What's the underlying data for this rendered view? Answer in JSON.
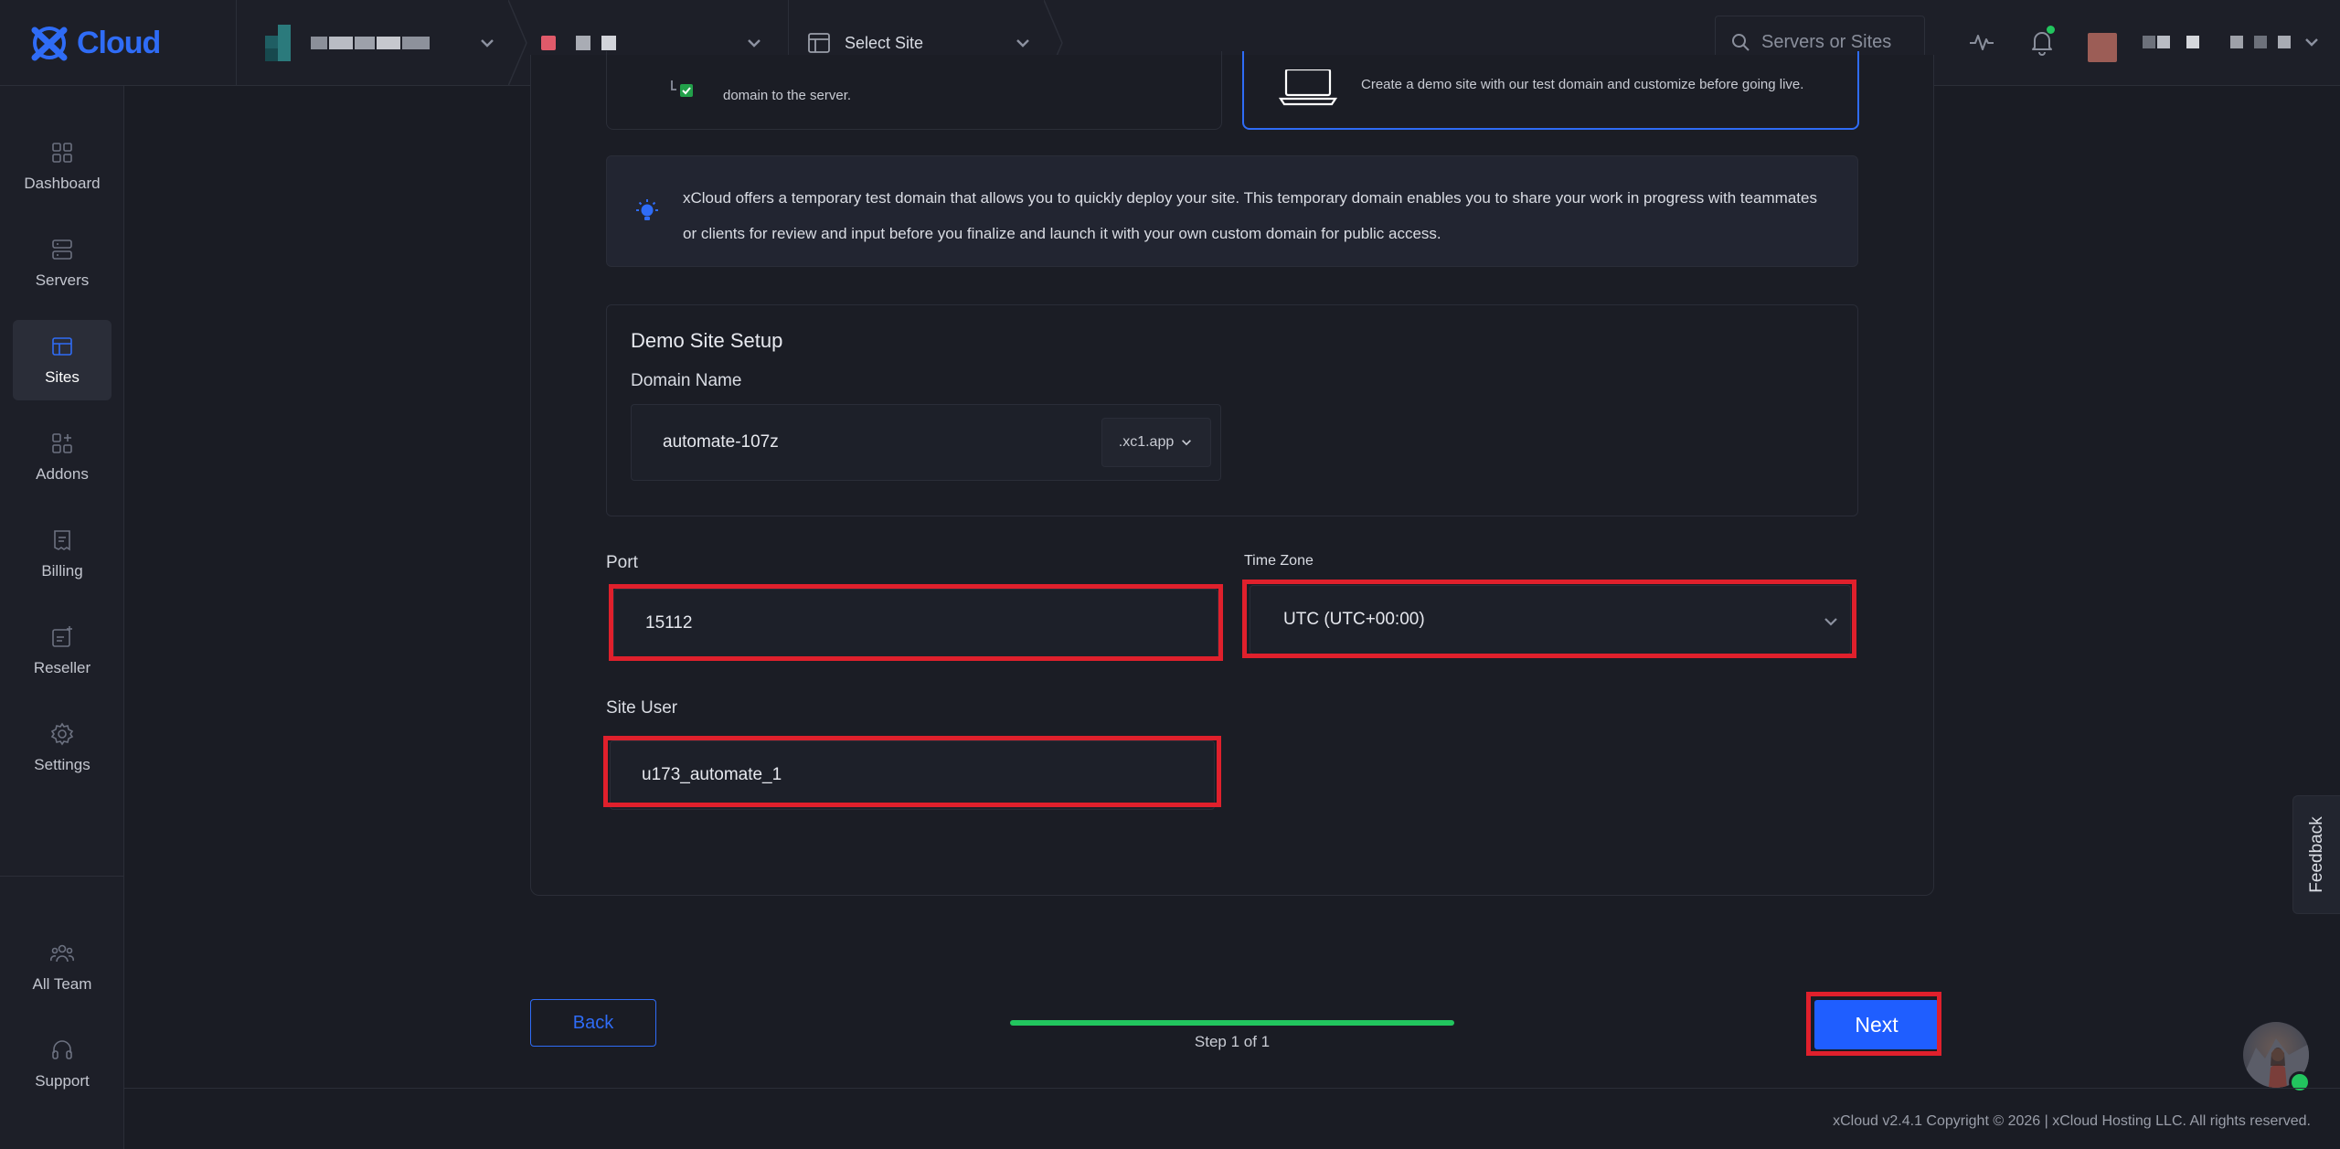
{
  "app": {
    "brand": "Cloud",
    "brand_color": "#2f6cf6",
    "accent_green": "#22c55e",
    "highlight_color": "#e0202c"
  },
  "topbar": {
    "select_site_label": "Select Site",
    "search_placeholder": "Servers or Sites"
  },
  "sidebar": {
    "items": [
      {
        "label": "Dashboard",
        "icon": "dashboard-icon"
      },
      {
        "label": "Servers",
        "icon": "servers-icon"
      },
      {
        "label": "Sites",
        "icon": "sites-icon",
        "active": true
      },
      {
        "label": "Addons",
        "icon": "addons-icon"
      },
      {
        "label": "Billing",
        "icon": "billing-icon"
      },
      {
        "label": "Reseller",
        "icon": "reseller-icon"
      },
      {
        "label": "Settings",
        "icon": "gear-icon"
      }
    ],
    "bottom_items": [
      {
        "label": "All Team",
        "icon": "team-icon"
      },
      {
        "label": "Support",
        "icon": "headset-icon"
      }
    ]
  },
  "options": {
    "left_text": "domain to the server.",
    "right_text": "Create a demo site with our test domain and customize before going live."
  },
  "info": {
    "text": "xCloud offers a temporary test domain that allows you to quickly deploy your site. This temporary domain enables you to share your work in progress with teammates or clients for review and input before you finalize and launch it with your own custom domain for public access."
  },
  "demo_setup": {
    "title": "Demo Site Setup",
    "domain_label": "Domain Name",
    "domain_value": "automate-107z",
    "tld": ".xc1.app"
  },
  "form": {
    "port_label": "Port",
    "port_value": "15112",
    "timezone_label": "Time Zone",
    "timezone_value": "UTC (UTC+00:00)",
    "site_user_label": "Site User",
    "site_user_value": "u173_automate_1"
  },
  "footer": {
    "back_label": "Back",
    "next_label": "Next",
    "step_text": "Step 1 of 1",
    "progress": 1.0,
    "feedback_label": "Feedback",
    "copyright": "xCloud v2.4.1 Copyright © 2026 | xCloud Hosting LLC. All rights reserved."
  }
}
